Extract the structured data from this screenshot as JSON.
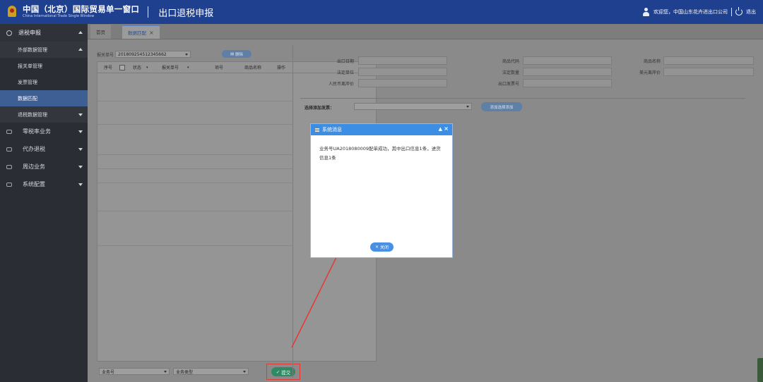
{
  "header": {
    "title_cn": "中国（北京）国际贸易单一窗口",
    "title_en": "China International Trade Single Window",
    "system": "出口退税申报",
    "welcome": "欢迎您，中国山东花卉进出口公司",
    "logout": "退出"
  },
  "sidebar": {
    "items": [
      {
        "label": "退税申报",
        "expanded": true
      },
      {
        "label": "外部数据管理",
        "level": 2,
        "expanded": true
      },
      {
        "label": "报关单管理",
        "level": 3
      },
      {
        "label": "发票管理",
        "level": 3
      },
      {
        "label": "数据匹配",
        "level": 3,
        "active": true
      },
      {
        "label": "退税数据管理",
        "level": 2
      },
      {
        "label": "零税率业务"
      },
      {
        "label": "代办退税"
      },
      {
        "label": "周边业务"
      },
      {
        "label": "系统配置"
      }
    ]
  },
  "tabs": [
    {
      "label": "首页"
    },
    {
      "label": "数据匹配",
      "active": true
    }
  ],
  "left": {
    "decl_label": "报关单号",
    "decl_value": "201809254512345662",
    "delete_btn": "删除",
    "columns": [
      "序号",
      "状态",
      "报关单号",
      "项号",
      "商品名称",
      "操作"
    ],
    "biz_no_placeholder": "业务号",
    "biz_type_placeholder": "业务类型",
    "confirm_btn": "提交"
  },
  "right": {
    "fields": {
      "export_date": "出口日期",
      "commodity_code": "商品代码",
      "commodity_name": "商品名称",
      "legal_unit": "法定单位",
      "legal_qty": "法定数量",
      "usd_price": "美元离岸价",
      "rmb_price": "人民币离岸价",
      "export_invoice": "出口发票号"
    },
    "add_invoice_label": "选择添加发票：",
    "add_invoice_btn": "添加选择添加"
  },
  "dialog": {
    "title": "系统消息",
    "message": "业务号UA2018080009配单成功，其中出口信息1条，进货信息1条",
    "close_btn": "关闭"
  }
}
